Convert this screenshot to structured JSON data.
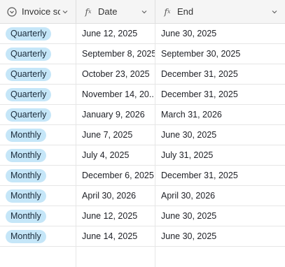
{
  "columns": [
    {
      "label": "Invoice sc..."
    },
    {
      "label": "Date"
    },
    {
      "label": "End"
    }
  ],
  "rows": [
    {
      "schedule": "Quarterly",
      "date": "June 12, 2025",
      "end": "June 30, 2025"
    },
    {
      "schedule": "Quarterly",
      "date": "September 8, 2025",
      "end": "September 30, 2025"
    },
    {
      "schedule": "Quarterly",
      "date": "October 23, 2025",
      "end": "December 31, 2025"
    },
    {
      "schedule": "Quarterly",
      "date": "November 14, 20...",
      "end": "December 31, 2025"
    },
    {
      "schedule": "Quarterly",
      "date": "January 9, 2026",
      "end": "March 31, 2026"
    },
    {
      "schedule": "Monthly",
      "date": "June 7, 2025",
      "end": "June 30, 2025"
    },
    {
      "schedule": "Monthly",
      "date": "July 4, 2025",
      "end": "July 31, 2025"
    },
    {
      "schedule": "Monthly",
      "date": "December 6, 2025",
      "end": "December 31, 2025"
    },
    {
      "schedule": "Monthly",
      "date": "April 30, 2026",
      "end": "April 30, 2026"
    },
    {
      "schedule": "Monthly",
      "date": "June 12, 2025",
      "end": "June 30, 2025"
    },
    {
      "schedule": "Monthly",
      "date": "June 14, 2025",
      "end": "June 30, 2025"
    }
  ],
  "colors": {
    "pill_bg": "#c5e6f8",
    "header_bg": "#f5f5f5"
  },
  "icons": {
    "schedule_column": "chevron-circle-icon",
    "formula_column": "fx-icon",
    "menu": "chevron-down-icon"
  }
}
